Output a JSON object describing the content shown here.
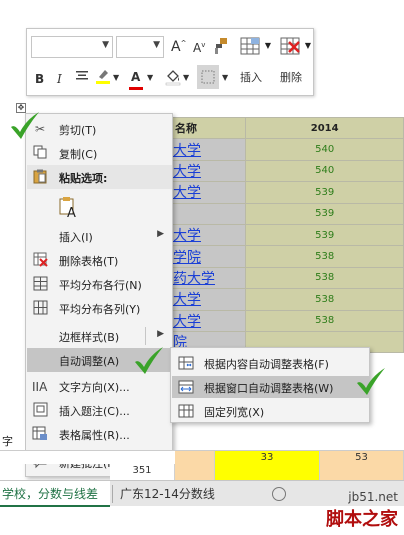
{
  "mini_toolbar": {
    "grow_font_label": "A",
    "shrink_font_label": "A",
    "bold_label": "B",
    "italic_label": "I",
    "font_color_letter": "A",
    "insert_label": "插入",
    "delete_label": "删除",
    "highlight_color": "#ffff00",
    "font_color": "#e00000"
  },
  "table": {
    "header": {
      "name": "名称",
      "year": "2014"
    },
    "rows": [
      {
        "name": "大学",
        "value": "540"
      },
      {
        "name": "大学",
        "value": "540"
      },
      {
        "name": "大学",
        "value": "539"
      },
      {
        "name": "",
        "value": "539"
      },
      {
        "name": "大学",
        "value": "539"
      },
      {
        "name": "学院",
        "value": "538"
      },
      {
        "name": "药大学",
        "value": "538"
      },
      {
        "name": "大学",
        "value": "538"
      },
      {
        "name": "大学",
        "value": "538"
      },
      {
        "name": "院",
        "value": ""
      }
    ]
  },
  "context_menu": {
    "items": [
      {
        "label": "剪切(T)",
        "icon": "scissors-icon"
      },
      {
        "label": "复制(C)",
        "icon": "copy-icon"
      },
      {
        "label": "粘贴选项:",
        "icon": "clipboard-icon"
      },
      {
        "label": "",
        "icon": "paste-keep-text-icon"
      },
      {
        "label": "插入(I)",
        "icon": ""
      },
      {
        "label": "删除表格(T)",
        "icon": "delete-table-icon"
      },
      {
        "label": "平均分布各行(N)",
        "icon": "distribute-rows-icon"
      },
      {
        "label": "平均分布各列(Y)",
        "icon": "distribute-columns-icon"
      },
      {
        "label": "边框样式(B)",
        "icon": ""
      },
      {
        "label": "自动调整(A)",
        "icon": ""
      },
      {
        "label": "文字方向(X)...",
        "icon": "text-direction-icon"
      },
      {
        "label": "插入题注(C)...",
        "icon": "insert-caption-icon"
      },
      {
        "label": "表格属性(R)...",
        "icon": "table-properties-icon"
      },
      {
        "label": "新建批注(M)",
        "icon": "new-comment-icon"
      }
    ]
  },
  "autofit_submenu": {
    "items": [
      {
        "label": "根据内容自动调整表格(F)",
        "icon": "autofit-contents-icon"
      },
      {
        "label": "根据窗口自动调整表格(W)",
        "icon": "autofit-window-icon"
      },
      {
        "label": "固定列宽(X)",
        "icon": "fixed-column-width-icon"
      }
    ]
  },
  "bottom": {
    "word_tab_fragment": "字",
    "excel_values": [
      "33",
      "53"
    ],
    "row2_fragment": "351",
    "sheet_tabs": [
      "学校，分数与线差",
      "广东12-14分数线"
    ]
  },
  "watermark": {
    "line1": "jb51.net",
    "line2": "脚本之家"
  },
  "colors": {
    "checkmark": "#3aa329",
    "excel_green": "#217346",
    "excel_yellow": "#ffff00",
    "excel_orange": "#fbd9a7"
  }
}
